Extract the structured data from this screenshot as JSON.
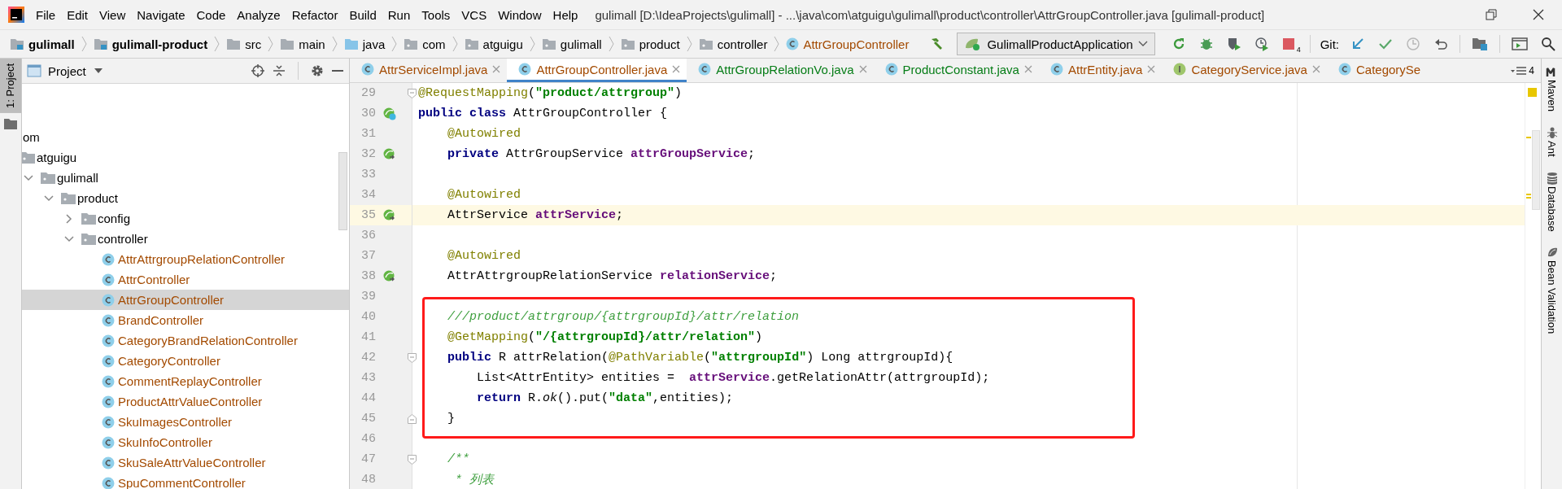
{
  "menu_bar": {
    "items": [
      "File",
      "Edit",
      "View",
      "Navigate",
      "Code",
      "Analyze",
      "Refactor",
      "Build",
      "Run",
      "Tools",
      "VCS",
      "Window",
      "Help"
    ]
  },
  "window": {
    "title": "gulimall [D:\\IdeaProjects\\gulimall] - ...\\java\\com\\atguigu\\gulimall\\product\\controller\\AttrGroupController.java [gulimall-product]"
  },
  "nav_bar": {
    "breadcrumbs": [
      {
        "label": "gulimall",
        "kind": "module"
      },
      {
        "label": "gulimall-product",
        "kind": "module"
      },
      {
        "label": "src",
        "kind": "folder"
      },
      {
        "label": "main",
        "kind": "folder"
      },
      {
        "label": "java",
        "kind": "source"
      },
      {
        "label": "com",
        "kind": "package"
      },
      {
        "label": "atguigu",
        "kind": "package"
      },
      {
        "label": "gulimall",
        "kind": "package"
      },
      {
        "label": "product",
        "kind": "package"
      },
      {
        "label": "controller",
        "kind": "package"
      },
      {
        "label": "AttrGroupController",
        "kind": "class"
      }
    ],
    "run_config": "GulimallProductApplication",
    "stop_badge": "4",
    "git_label": "Git:"
  },
  "left_stripe": {
    "tabs": [
      {
        "label": "1: Project",
        "selected": true
      }
    ]
  },
  "project_panel": {
    "title": "Project",
    "tree": [
      {
        "label": "om",
        "selected": false,
        "children": [
          {
            "label": "atguigu",
            "kind": "folder",
            "selected": false,
            "children": [
              {
                "label": "gulimall",
                "kind": "folder",
                "expanded": true,
                "selected": false,
                "children": [
                  {
                    "label": "product",
                    "kind": "folder",
                    "expanded": true,
                    "selected": false,
                    "children": [
                      {
                        "label": "config",
                        "kind": "folder",
                        "expanded": false,
                        "selected": false
                      },
                      {
                        "label": "controller",
                        "kind": "folder",
                        "expanded": true,
                        "selected": false,
                        "children": [
                          {
                            "label": "AttrAttrgroupRelationController",
                            "kind": "class",
                            "color": "#a34a00",
                            "selected": false
                          },
                          {
                            "label": "AttrController",
                            "kind": "class",
                            "color": "#a34a00",
                            "selected": false
                          },
                          {
                            "label": "AttrGroupController",
                            "kind": "class",
                            "color": "#a34a00",
                            "selected": true
                          },
                          {
                            "label": "BrandController",
                            "kind": "class",
                            "color": "#a34a00",
                            "selected": false
                          },
                          {
                            "label": "CategoryBrandRelationController",
                            "kind": "class",
                            "color": "#a34a00",
                            "selected": false
                          },
                          {
                            "label": "CategoryController",
                            "kind": "class",
                            "color": "#a34a00",
                            "selected": false
                          },
                          {
                            "label": "CommentReplayController",
                            "kind": "class",
                            "color": "#a34a00",
                            "selected": false
                          },
                          {
                            "label": "ProductAttrValueController",
                            "kind": "class",
                            "color": "#a34a00",
                            "selected": false
                          },
                          {
                            "label": "SkuImagesController",
                            "kind": "class",
                            "color": "#a34a00",
                            "selected": false
                          },
                          {
                            "label": "SkuInfoController",
                            "kind": "class",
                            "color": "#a34a00",
                            "selected": false
                          },
                          {
                            "label": "SkuSaleAttrValueController",
                            "kind": "class",
                            "color": "#a34a00",
                            "selected": false
                          },
                          {
                            "label": "SpuCommentController",
                            "kind": "class",
                            "color": "#a34a00",
                            "selected": false
                          }
                        ]
                      }
                    ]
                  }
                ]
              }
            ]
          }
        ]
      }
    ]
  },
  "editor": {
    "tabs": [
      {
        "label": "AttrServiceImpl.java",
        "kind": "class",
        "color": "#a34a00",
        "selected": false,
        "closable": true
      },
      {
        "label": "AttrGroupController.java",
        "kind": "class",
        "color": "#a34a00",
        "selected": true,
        "closable": true
      },
      {
        "label": "AttrGroupRelationVo.java",
        "kind": "class",
        "color": "#067d17",
        "selected": false,
        "closable": true
      },
      {
        "label": "ProductConstant.java",
        "kind": "class",
        "color": "#067d17",
        "selected": false,
        "closable": true
      },
      {
        "label": "AttrEntity.java",
        "kind": "class",
        "color": "#a34a00",
        "selected": false,
        "closable": true
      },
      {
        "label": "CategoryService.java",
        "kind": "interface",
        "color": "#a34a00",
        "selected": false,
        "closable": true
      },
      {
        "label": "CategorySe",
        "kind": "class",
        "color": "#a34a00",
        "selected": false,
        "closable": false
      }
    ],
    "hidden_tabs": "4",
    "lines": [
      {
        "number": "29",
        "kind": "fold-start",
        "current": false,
        "boxed": false,
        "tokens": [
          {
            "text": "@RequestMapping",
            "kind": "annotation"
          },
          {
            "text": "(",
            "kind": "plain"
          },
          {
            "text": "\"product/attrgroup\"",
            "kind": "string"
          },
          {
            "text": ")",
            "kind": "plain"
          }
        ]
      },
      {
        "number": "30",
        "kind": "class-bean",
        "current": false,
        "boxed": false,
        "tokens": [
          {
            "text": "public class ",
            "kind": "keyword"
          },
          {
            "text": "AttrGroupController {",
            "kind": "plain"
          }
        ]
      },
      {
        "number": "31",
        "kind": "plain",
        "current": false,
        "boxed": false,
        "tokens": [
          {
            "text": "    @Autowired",
            "kind": "annotation"
          }
        ]
      },
      {
        "number": "32",
        "kind": "injected",
        "current": false,
        "boxed": false,
        "tokens": [
          {
            "text": "    private ",
            "kind": "keyword"
          },
          {
            "text": "AttrGroupService ",
            "kind": "plain"
          },
          {
            "text": "attrGroupService",
            "kind": "field"
          },
          {
            "text": ";",
            "kind": "plain"
          }
        ]
      },
      {
        "number": "33",
        "kind": "plain",
        "current": false,
        "boxed": false
      },
      {
        "number": "34",
        "kind": "plain",
        "current": false,
        "boxed": false,
        "tokens": [
          {
            "text": "    @Autowired",
            "kind": "annotation"
          }
        ]
      },
      {
        "number": "35",
        "kind": "injected",
        "current": true,
        "boxed": false,
        "tokens": [
          {
            "text": "    AttrService ",
            "kind": "plain"
          },
          {
            "text": "attrService",
            "kind": "field"
          },
          {
            "text": ";",
            "kind": "plain"
          }
        ]
      },
      {
        "number": "36",
        "kind": "plain",
        "current": false,
        "boxed": false
      },
      {
        "number": "37",
        "kind": "plain",
        "current": false,
        "boxed": false,
        "tokens": [
          {
            "text": "    @Autowired",
            "kind": "annotation"
          }
        ]
      },
      {
        "number": "38",
        "kind": "injected",
        "current": false,
        "boxed": false,
        "tokens": [
          {
            "text": "    AttrAttrgroupRelationService ",
            "kind": "plain"
          },
          {
            "text": "relationService",
            "kind": "field"
          },
          {
            "text": ";",
            "kind": "plain"
          }
        ]
      },
      {
        "number": "39",
        "kind": "plain",
        "current": false,
        "boxed": false
      },
      {
        "number": "40",
        "kind": "plain",
        "current": false,
        "boxed": true,
        "tokens": [
          {
            "text": "    ///product/attrgroup/{attrgroupId}/attr/relation",
            "kind": "comment"
          }
        ]
      },
      {
        "number": "41",
        "kind": "plain",
        "current": false,
        "boxed": true,
        "tokens": [
          {
            "text": "    @GetMapping",
            "kind": "annotation"
          },
          {
            "text": "(",
            "kind": "plain"
          },
          {
            "text": "\"/{attrgroupId}/attr/relation\"",
            "kind": "string"
          },
          {
            "text": ")",
            "kind": "plain"
          }
        ]
      },
      {
        "number": "42",
        "kind": "fold-start",
        "current": false,
        "boxed": true,
        "tokens": [
          {
            "text": "    public ",
            "kind": "keyword"
          },
          {
            "text": "R attrRelation(",
            "kind": "plain"
          },
          {
            "text": "@PathVariable",
            "kind": "annotation"
          },
          {
            "text": "(",
            "kind": "plain"
          },
          {
            "text": "\"attrgroupId\"",
            "kind": "string"
          },
          {
            "text": ") Long attrgroupId){",
            "kind": "plain"
          }
        ]
      },
      {
        "number": "43",
        "kind": "plain",
        "current": false,
        "boxed": true,
        "tokens": [
          {
            "text": "        List<AttrEntity> entities =  ",
            "kind": "plain"
          },
          {
            "text": "attrService",
            "kind": "field"
          },
          {
            "text": ".getRelationAttr(attrgroupId);",
            "kind": "plain"
          }
        ]
      },
      {
        "number": "44",
        "kind": "plain",
        "current": false,
        "boxed": true,
        "tokens": [
          {
            "text": "        return ",
            "kind": "keyword"
          },
          {
            "text": "R.",
            "kind": "plain"
          },
          {
            "text": "ok",
            "kind": "static"
          },
          {
            "text": "().put(",
            "kind": "plain"
          },
          {
            "text": "\"data\"",
            "kind": "string"
          },
          {
            "text": ",entities);",
            "kind": "plain"
          }
        ]
      },
      {
        "number": "45",
        "kind": "fold-end",
        "current": false,
        "boxed": true,
        "tokens": [
          {
            "text": "    }",
            "kind": "plain"
          }
        ]
      },
      {
        "number": "46",
        "kind": "plain",
        "current": false,
        "boxed": false
      },
      {
        "number": "47",
        "kind": "fold-start",
        "current": false,
        "boxed": false,
        "tokens": [
          {
            "text": "    /**",
            "kind": "doc"
          }
        ]
      },
      {
        "number": "48",
        "kind": "plain",
        "current": false,
        "boxed": false,
        "tokens": [
          {
            "text": "     * 列表",
            "kind": "doc"
          }
        ]
      }
    ]
  },
  "right_stripe": {
    "tabs": [
      {
        "label": "Maven"
      },
      {
        "label": "Ant"
      },
      {
        "label": "Database"
      },
      {
        "label": "Bean Validation"
      }
    ]
  }
}
